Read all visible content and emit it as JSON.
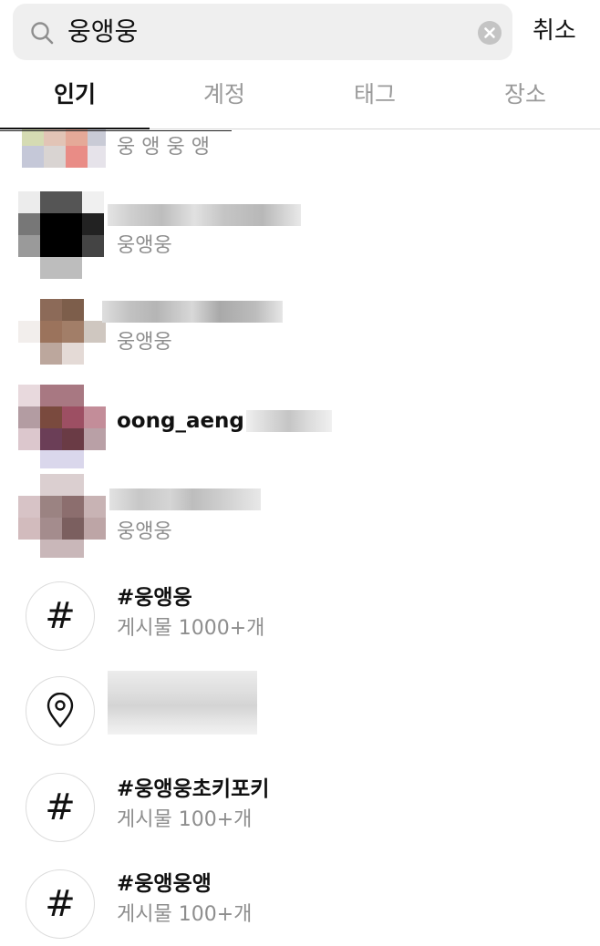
{
  "search": {
    "query": "웅앵웅",
    "cancel_label": "취소"
  },
  "tabs": [
    {
      "label": "인기",
      "active": true
    },
    {
      "label": "계정",
      "active": false
    },
    {
      "label": "태그",
      "active": false
    },
    {
      "label": "장소",
      "active": false
    }
  ],
  "results": [
    {
      "type": "account",
      "subtitle": "웅 앵 웅 앵"
    },
    {
      "type": "account",
      "subtitle": "웅앵웅"
    },
    {
      "type": "account",
      "subtitle": "웅앵웅"
    },
    {
      "type": "account",
      "username": "oong_aeng"
    },
    {
      "type": "account",
      "subtitle": "웅앵웅"
    },
    {
      "type": "hashtag",
      "icon": "hashtag-icon",
      "title": "#웅앵웅",
      "subtitle": "게시물 1000+개"
    },
    {
      "type": "place",
      "icon": "location-pin-icon"
    },
    {
      "type": "hashtag",
      "icon": "hashtag-icon",
      "title": "#웅앵웅초키포키",
      "subtitle": "게시물 100+개"
    },
    {
      "type": "hashtag",
      "icon": "hashtag-icon",
      "title": "#웅앵웅앵",
      "subtitle": "게시물 100+개"
    }
  ]
}
